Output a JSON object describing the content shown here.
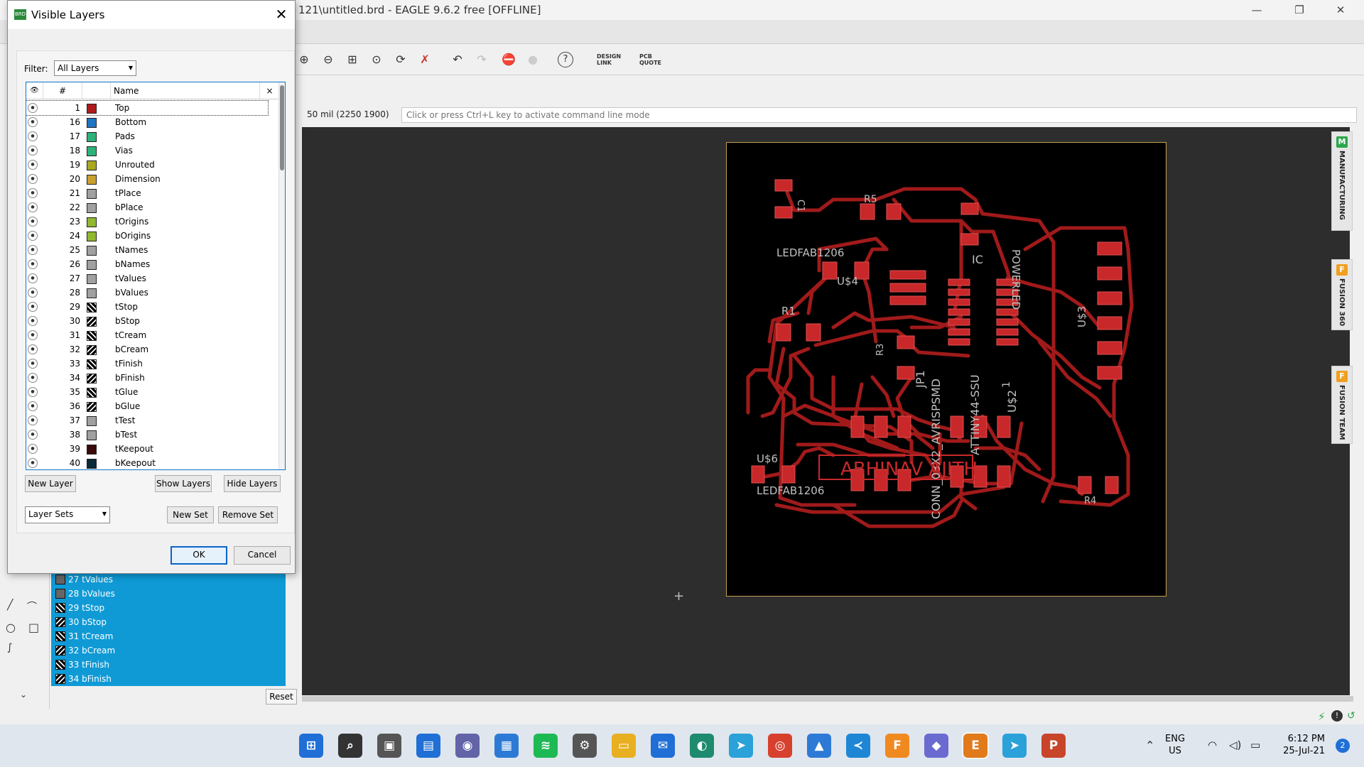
{
  "window": {
    "title": "121\\untitled.brd - EAGLE 9.6.2 free [OFFLINE]",
    "minimize": "—",
    "maximize": "❐",
    "close": "✕"
  },
  "toolbar": {
    "zoom_in": "⊕",
    "zoom_out": "⊖",
    "zoom_fit": "⊞",
    "zoom_select": "⊙",
    "redraw": "⟳",
    "ratsnest": "✗",
    "undo": "↶",
    "redo": "↷",
    "stop": "⛔",
    "go": "●",
    "help": "?",
    "design_link": "DESIGN\nLINK",
    "pcb_quote": "PCB\nQUOTE"
  },
  "command": {
    "coordinates": "50 mil (2250 1900)",
    "placeholder": "Click or press Ctrl+L key to activate command line mode"
  },
  "right_dock": [
    {
      "label": "MANUFACTURING",
      "icon": "manufacturing-icon",
      "color": "#2aa84a"
    },
    {
      "label": "FUSION 360",
      "icon": "fusion360-icon",
      "color": "#f0a020"
    },
    {
      "label": "FUSION TEAM",
      "icon": "fusion-team-icon",
      "color": "#f0a020"
    }
  ],
  "background_layer_list": {
    "items": [
      "27 tValues",
      "28 bValues",
      "29 tStop",
      "30 bStop",
      "31 tCream",
      "32 bCream",
      "33 tFinish",
      "34 bFinish"
    ],
    "reset_label": "Reset"
  },
  "dialog": {
    "title": "Visible Layers",
    "close": "✕",
    "filter_label": "Filter:",
    "filter_value": "All Layers",
    "columns": {
      "visible": "👁",
      "number": "#",
      "name": "Name",
      "clear": "×"
    },
    "layers": [
      {
        "num": "1",
        "name": "Top",
        "color": "#b11a1a"
      },
      {
        "num": "16",
        "name": "Bottom",
        "color": "#1f74c4"
      },
      {
        "num": "17",
        "name": "Pads",
        "color": "#2db27a"
      },
      {
        "num": "18",
        "name": "Vias",
        "color": "#2db27a"
      },
      {
        "num": "19",
        "name": "Unrouted",
        "color": "#a8a820"
      },
      {
        "num": "20",
        "name": "Dimension",
        "color": "#c8a030"
      },
      {
        "num": "21",
        "name": "tPlace",
        "color": "#a0a0a0"
      },
      {
        "num": "22",
        "name": "bPlace",
        "color": "#a0a0a0"
      },
      {
        "num": "23",
        "name": "tOrigins",
        "color": "#90b830"
      },
      {
        "num": "24",
        "name": "bOrigins",
        "color": "#90b830"
      },
      {
        "num": "25",
        "name": "tNames",
        "color": "#a0a0a0"
      },
      {
        "num": "26",
        "name": "bNames",
        "color": "#a0a0a0"
      },
      {
        "num": "27",
        "name": "tValues",
        "color": "#a0a0a0"
      },
      {
        "num": "28",
        "name": "bValues",
        "color": "#a0a0a0"
      },
      {
        "num": "29",
        "name": "tStop",
        "color": "hatch"
      },
      {
        "num": "30",
        "name": "bStop",
        "color": "hatch2"
      },
      {
        "num": "31",
        "name": "tCream",
        "color": "hatch"
      },
      {
        "num": "32",
        "name": "bCream",
        "color": "hatch2"
      },
      {
        "num": "33",
        "name": "tFinish",
        "color": "hatch"
      },
      {
        "num": "34",
        "name": "bFinish",
        "color": "hatch2"
      },
      {
        "num": "35",
        "name": "tGlue",
        "color": "hatch"
      },
      {
        "num": "36",
        "name": "bGlue",
        "color": "hatch2"
      },
      {
        "num": "37",
        "name": "tTest",
        "color": "#a0a0a0"
      },
      {
        "num": "38",
        "name": "bTest",
        "color": "#a0a0a0"
      },
      {
        "num": "39",
        "name": "tKeepout",
        "color": "#3a0a0a"
      },
      {
        "num": "40",
        "name": "bKeepout",
        "color": "#0a2a3a"
      }
    ],
    "buttons": {
      "new_layer": "New Layer",
      "show_layers": "Show Layers",
      "hide_layers": "Hide Layers",
      "layer_sets": "Layer Sets",
      "new_set": "New Set",
      "remove_set": "Remove Set",
      "ok": "OK",
      "cancel": "Cancel"
    }
  },
  "board": {
    "labels": [
      "C1",
      "R5",
      "LEDFAB1206",
      "U$4",
      "R1",
      "R3",
      "IC",
      "ATTINY44-SSU",
      "POWERLED",
      "U$3",
      "JP1",
      "CONN_03X2_AVRISPSMD",
      "1",
      "U$2",
      "U$6",
      "LEDFAB1206",
      "R4",
      "ABHINAV AJITH"
    ],
    "trace_color": "#a11a1a",
    "pad_color": "#c8282a"
  },
  "taskbar": {
    "apps": [
      {
        "name": "start-button",
        "glyph": "⊞",
        "color": "#1f6fd6"
      },
      {
        "name": "search-icon",
        "glyph": "⌕",
        "color": "#333"
      },
      {
        "name": "task-view-icon",
        "glyph": "▣",
        "color": "#555"
      },
      {
        "name": "widgets-icon",
        "glyph": "▤",
        "color": "#1f6fd6"
      },
      {
        "name": "teams-chat-icon",
        "glyph": "◉",
        "color": "#6264a7"
      },
      {
        "name": "store-icon",
        "glyph": "▦",
        "color": "#2d7ad6"
      },
      {
        "name": "spotify-icon",
        "glyph": "≋",
        "color": "#1db954"
      },
      {
        "name": "settings-icon",
        "glyph": "⚙",
        "color": "#555"
      },
      {
        "name": "file-explorer-icon",
        "glyph": "▭",
        "color": "#e8b020"
      },
      {
        "name": "mail-icon",
        "glyph": "✉",
        "color": "#1f6fd6"
      },
      {
        "name": "edge-icon",
        "glyph": "◐",
        "color": "#1e8a6e"
      },
      {
        "name": "telegram-icon",
        "glyph": "➤",
        "color": "#2aa1d8"
      },
      {
        "name": "chrome-icon",
        "glyph": "◎",
        "color": "#d8402e"
      },
      {
        "name": "photos-icon",
        "glyph": "▲",
        "color": "#2d7ad6"
      },
      {
        "name": "vscode-icon",
        "glyph": "≺",
        "color": "#1f86d6"
      },
      {
        "name": "fusion-icon",
        "glyph": "F",
        "color": "#f08a20"
      },
      {
        "name": "git-icon",
        "glyph": "◆",
        "color": "#6a6ad0"
      },
      {
        "name": "eagle-icon",
        "glyph": "E",
        "color": "#e07a1a"
      },
      {
        "name": "telegram2-icon",
        "glyph": "➤",
        "color": "#2aa1d8"
      },
      {
        "name": "powerpoint-icon",
        "glyph": "P",
        "color": "#c8442a"
      }
    ],
    "lang": "ENG",
    "region": "US",
    "time": "6:12 PM",
    "date": "25-Jul-21",
    "notifications": "2"
  }
}
